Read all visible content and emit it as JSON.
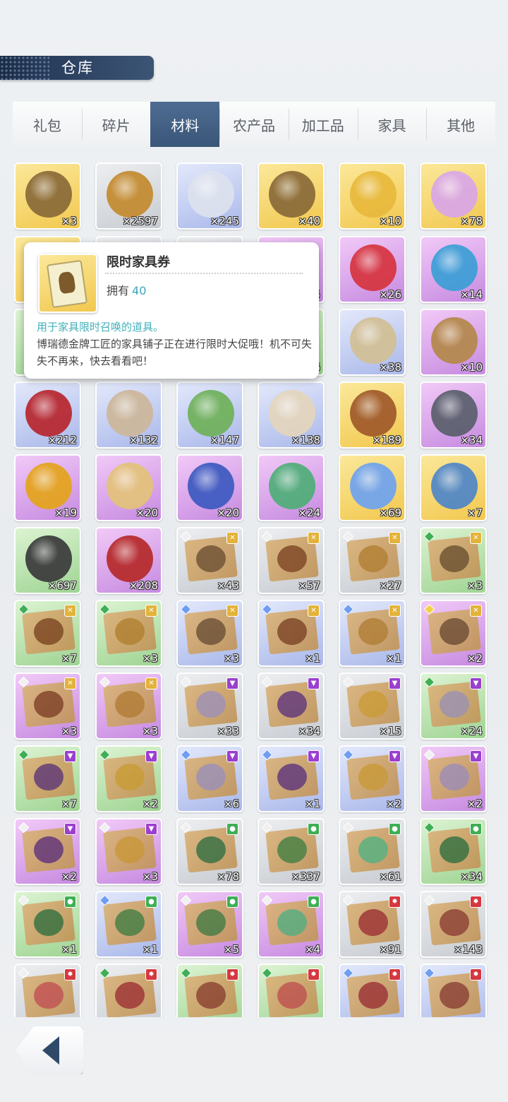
{
  "header": {
    "title": "仓库"
  },
  "tabs": [
    {
      "label": "礼包",
      "active": false
    },
    {
      "label": "碎片",
      "active": false
    },
    {
      "label": "材料",
      "active": true
    },
    {
      "label": "农产品",
      "active": false
    },
    {
      "label": "加工品",
      "active": false
    },
    {
      "label": "家具",
      "active": false
    },
    {
      "label": "其他",
      "active": false
    }
  ],
  "items": [
    {
      "count": "×3",
      "bg": "gold",
      "art": "ticket-icon",
      "color": "#8a6a38"
    },
    {
      "count": "×2597",
      "bg": "gray",
      "art": "medal-icon",
      "color": "#c48a2e"
    },
    {
      "count": "×245",
      "bg": "blue",
      "art": "herb-icon",
      "color": "#dde2ee"
    },
    {
      "count": "×40",
      "bg": "gold",
      "art": "ticket-icon",
      "color": "#8a6a38"
    },
    {
      "count": "×10",
      "bg": "gold",
      "art": "puzzle-icon",
      "color": "#e8b93c"
    },
    {
      "count": "×78",
      "bg": "gold",
      "art": "potion-icon",
      "color": "#d9a6e8"
    },
    {
      "count": "",
      "bg": "gold",
      "art": "ticket-icon",
      "color": "#8a6a38"
    },
    {
      "count": "",
      "bg": "gray",
      "art": "medal-icon",
      "color": "#c48a2e"
    },
    {
      "count": "",
      "bg": "gray",
      "art": "box-icon",
      "color": "#b59a73"
    },
    {
      "count": "×5",
      "bg": "purple",
      "art": "box-icon",
      "color": "#8b5fb0"
    },
    {
      "count": "×26",
      "bg": "purple",
      "art": "red-book-icon",
      "color": "#d6343e"
    },
    {
      "count": "×14",
      "bg": "purple",
      "art": "blue-book-icon",
      "color": "#3c9fd6"
    },
    {
      "count": "",
      "bg": "green",
      "art": "box-icon",
      "color": "#9f7a45"
    },
    {
      "count": "",
      "bg": "blue",
      "art": "box-icon",
      "color": "#9f7a45"
    },
    {
      "count": "",
      "bg": "blue",
      "art": "box-icon",
      "color": "#9f7a45"
    },
    {
      "count": "×6",
      "bg": "green",
      "art": "box-icon",
      "color": "#9f7a45"
    },
    {
      "count": "×38",
      "bg": "blue",
      "art": "scroll-icon",
      "color": "#d2bf94"
    },
    {
      "count": "×10",
      "bg": "purple",
      "art": "scroll-icon",
      "color": "#b4884a"
    },
    {
      "count": "×212",
      "bg": "blue",
      "art": "seal-letter-icon",
      "color": "#b8262e"
    },
    {
      "count": "×132",
      "bg": "blue",
      "art": "fossil-icon",
      "color": "#cdb79a"
    },
    {
      "count": "×147",
      "bg": "blue",
      "art": "jar-icon",
      "color": "#6fb15a"
    },
    {
      "count": "×138",
      "bg": "blue",
      "art": "bone-icon",
      "color": "#e4d6bd"
    },
    {
      "count": "×189",
      "bg": "gold",
      "art": "ring-icon",
      "color": "#a05a2a"
    },
    {
      "count": "×34",
      "bg": "purple",
      "art": "stone-tablet-icon",
      "color": "#5a5f6c"
    },
    {
      "count": "×19",
      "bg": "purple",
      "art": "amber-icon",
      "color": "#e5a41c"
    },
    {
      "count": "×20",
      "bg": "purple",
      "art": "food-icon",
      "color": "#e4c27a"
    },
    {
      "count": "×20",
      "bg": "purple",
      "art": "necklace-icon",
      "color": "#3d5ac0"
    },
    {
      "count": "×24",
      "bg": "purple",
      "art": "leaf-pearl-icon",
      "color": "#4fae78"
    },
    {
      "count": "×69",
      "bg": "gold",
      "art": "crystal-icon",
      "color": "#6fa3f0"
    },
    {
      "count": "×7",
      "bg": "gold",
      "art": "house-icon",
      "color": "#4f86c8"
    },
    {
      "count": "×697",
      "bg": "green",
      "art": "ore-icon",
      "color": "#3a3a3a"
    },
    {
      "count": "×208",
      "bg": "purple",
      "art": "lava-ore-icon",
      "color": "#b62a2a"
    },
    {
      "count": "×43",
      "bg": "gray",
      "art": "blueprint-icon",
      "color": "#6a4a2a",
      "badge": "gold",
      "gem": "#f0f0f0"
    },
    {
      "count": "×57",
      "bg": "gray",
      "art": "blueprint-icon",
      "color": "#7a3e1a",
      "badge": "gold",
      "gem": "#f0f0f0"
    },
    {
      "count": "×27",
      "bg": "gray",
      "art": "blueprint-icon",
      "color": "#b07a2a",
      "badge": "gold",
      "gem": "#f0f0f0"
    },
    {
      "count": "×3",
      "bg": "green",
      "art": "blueprint-icon",
      "color": "#6a4a2a",
      "badge": "gold",
      "gem": "#3fae55"
    },
    {
      "count": "×7",
      "bg": "green",
      "art": "blueprint-icon",
      "color": "#7a3e1a",
      "badge": "gold",
      "gem": "#3fae55"
    },
    {
      "count": "×3",
      "bg": "green",
      "art": "blueprint-icon",
      "color": "#b07a2a",
      "badge": "gold",
      "gem": "#3fae55"
    },
    {
      "count": "×3",
      "bg": "blue",
      "art": "blueprint-icon",
      "color": "#6a4a2a",
      "badge": "gold",
      "gem": "#6f9df0"
    },
    {
      "count": "×1",
      "bg": "blue",
      "art": "blueprint-icon",
      "color": "#7a3e1a",
      "badge": "gold",
      "gem": "#6f9df0"
    },
    {
      "count": "×1",
      "bg": "blue",
      "art": "blueprint-icon",
      "color": "#b07a2a",
      "badge": "gold",
      "gem": "#6f9df0"
    },
    {
      "count": "×2",
      "bg": "purple",
      "art": "blueprint-icon",
      "color": "#6a4a2a",
      "badge": "gold",
      "gem": "#f0d24a"
    },
    {
      "count": "×3",
      "bg": "purple",
      "art": "blueprint-icon",
      "color": "#7a3e1a",
      "badge": "gold",
      "gem": "#f0f0f0"
    },
    {
      "count": "×3",
      "bg": "purple",
      "art": "blueprint-icon",
      "color": "#b07a2a",
      "badge": "gold",
      "gem": "#f0f0f0"
    },
    {
      "count": "×33",
      "bg": "gray",
      "art": "blueprint-icon",
      "color": "#9a8cb0",
      "badge": "purple",
      "gem": "#f0f0f0"
    },
    {
      "count": "×34",
      "bg": "gray",
      "art": "blueprint-icon",
      "color": "#5c2f72",
      "badge": "purple",
      "gem": "#f0f0f0"
    },
    {
      "count": "×15",
      "bg": "gray",
      "art": "blueprint-icon",
      "color": "#c9962e",
      "badge": "purple",
      "gem": "#f0f0f0"
    },
    {
      "count": "×24",
      "bg": "green",
      "art": "blueprint-icon",
      "color": "#9a8cb0",
      "badge": "purple",
      "gem": "#3fae55"
    },
    {
      "count": "×7",
      "bg": "green",
      "art": "blueprint-icon",
      "color": "#5c2f72",
      "badge": "purple",
      "gem": "#3fae55"
    },
    {
      "count": "×2",
      "bg": "green",
      "art": "blueprint-icon",
      "color": "#c9962e",
      "badge": "purple",
      "gem": "#3fae55"
    },
    {
      "count": "×6",
      "bg": "blue",
      "art": "blueprint-icon",
      "color": "#9a8cb0",
      "badge": "purple",
      "gem": "#6f9df0"
    },
    {
      "count": "×1",
      "bg": "blue",
      "art": "blueprint-icon",
      "color": "#5c2f72",
      "badge": "purple",
      "gem": "#6f9df0"
    },
    {
      "count": "×2",
      "bg": "blue",
      "art": "blueprint-icon",
      "color": "#c9962e",
      "badge": "purple",
      "gem": "#6f9df0"
    },
    {
      "count": "×2",
      "bg": "purple",
      "art": "blueprint-icon",
      "color": "#9a8cb0",
      "badge": "purple",
      "gem": "#f0f0f0"
    },
    {
      "count": "×2",
      "bg": "purple",
      "art": "blueprint-icon",
      "color": "#5c2f72",
      "badge": "purple",
      "gem": "#f0f0f0"
    },
    {
      "count": "×3",
      "bg": "purple",
      "art": "blueprint-icon",
      "color": "#c9962e",
      "badge": "purple",
      "gem": "#f0f0f0"
    },
    {
      "count": "×78",
      "bg": "gray",
      "art": "blueprint-icon",
      "color": "#2f6a3a",
      "badge": "green",
      "gem": "#f0f0f0"
    },
    {
      "count": "×337",
      "bg": "gray",
      "art": "blueprint-icon",
      "color": "#3f7a3a",
      "badge": "green",
      "gem": "#f0f0f0"
    },
    {
      "count": "×61",
      "bg": "gray",
      "art": "blueprint-icon",
      "color": "#4fae78",
      "badge": "green",
      "gem": "#f0f0f0"
    },
    {
      "count": "×34",
      "bg": "green",
      "art": "blueprint-icon",
      "color": "#2f6a3a",
      "badge": "green",
      "gem": "#3fae55"
    },
    {
      "count": "×1",
      "bg": "green",
      "art": "blueprint-icon",
      "color": "#2f6a3a",
      "badge": "green",
      "gem": "#f0f0f0"
    },
    {
      "count": "×1",
      "bg": "blue",
      "art": "blueprint-icon",
      "color": "#3f7a3a",
      "badge": "green",
      "gem": "#6f9df0"
    },
    {
      "count": "×5",
      "bg": "purple",
      "art": "blueprint-icon",
      "color": "#3f7a3a",
      "badge": "green",
      "gem": "#f0f0f0"
    },
    {
      "count": "×4",
      "bg": "purple",
      "art": "blueprint-icon",
      "color": "#4fae78",
      "badge": "green",
      "gem": "#f0f0f0"
    },
    {
      "count": "×91",
      "bg": "gray",
      "art": "blueprint-icon",
      "color": "#9a2a2a",
      "badge": "red",
      "gem": "#f0f0f0"
    },
    {
      "count": "×143",
      "bg": "gray",
      "art": "blueprint-icon",
      "color": "#8a3a2a",
      "badge": "red",
      "gem": "#f0f0f0"
    },
    {
      "count": "",
      "bg": "gray",
      "art": "blueprint-icon",
      "color": "#c04a4a",
      "badge": "red",
      "gem": "#f0f0f0"
    },
    {
      "count": "",
      "bg": "gray",
      "art": "blueprint-icon",
      "color": "#9a2a2a",
      "badge": "red",
      "gem": "#3fae55"
    },
    {
      "count": "",
      "bg": "green",
      "art": "blueprint-icon",
      "color": "#8a3a2a",
      "badge": "red",
      "gem": "#3fae55"
    },
    {
      "count": "",
      "bg": "green",
      "art": "blueprint-icon",
      "color": "#c04a4a",
      "badge": "red",
      "gem": "#3fae55"
    },
    {
      "count": "",
      "bg": "blue",
      "art": "blueprint-icon",
      "color": "#9a2a2a",
      "badge": "red",
      "gem": "#6f9df0"
    },
    {
      "count": "",
      "bg": "blue",
      "art": "blueprint-icon",
      "color": "#8a3a2a",
      "badge": "red",
      "gem": "#6f9df0"
    }
  ],
  "tooltip": {
    "name": "限时家具券",
    "own_label": "拥有",
    "own_count": "40",
    "desc_highlight": "用于家具限时召唤的道具。",
    "desc_body": "博瑞德金牌工匠的家具铺子正在进行限时大促哦！机不可失失不再来，快去看看吧！",
    "icon": "ticket-icon"
  },
  "footer": {
    "back_icon": "back-arrow-icon"
  }
}
